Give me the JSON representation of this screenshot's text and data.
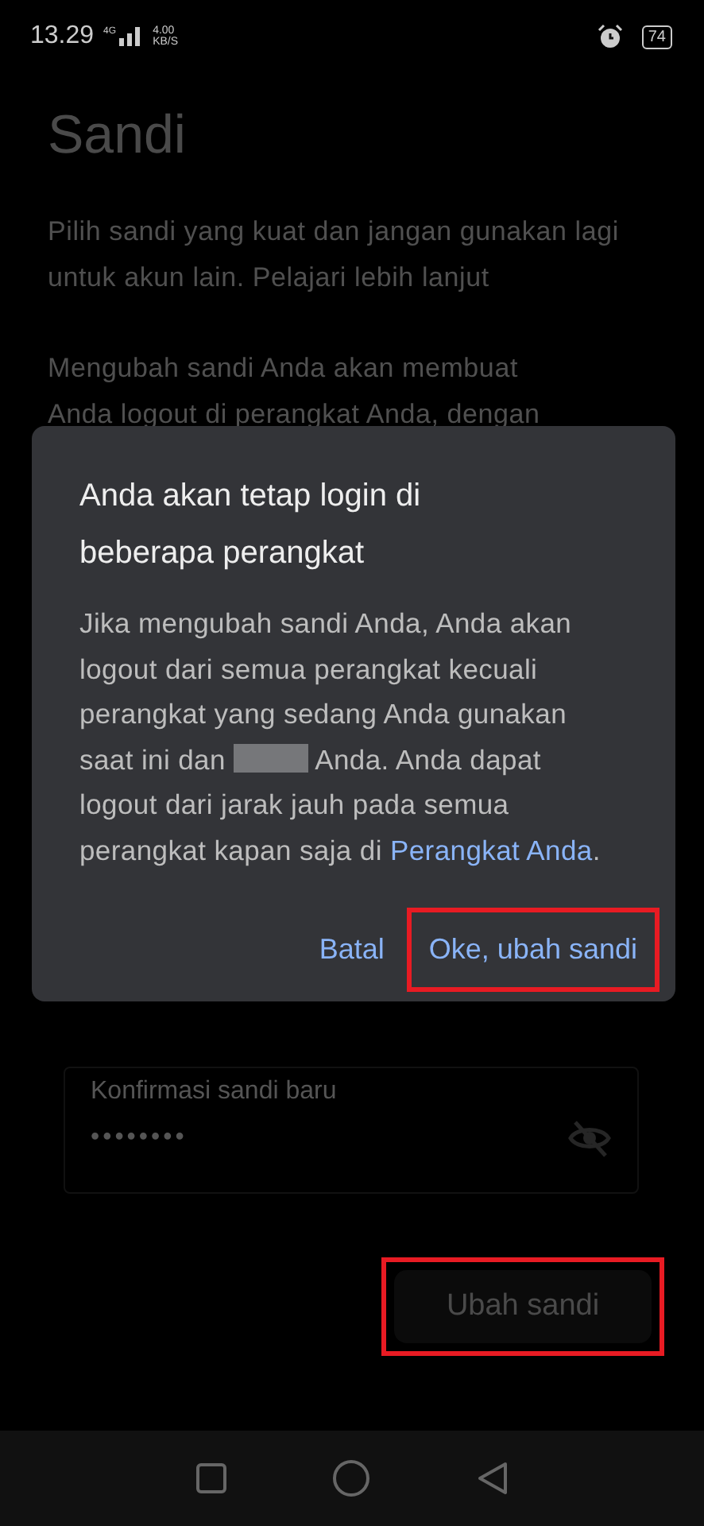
{
  "status_bar": {
    "time": "13.29",
    "network": "4G",
    "speed_value": "4.00",
    "speed_unit": "KB/S",
    "battery": "74"
  },
  "page": {
    "title": "Sandi",
    "intro": "Pilih sandi yang kuat dan jangan gunakan lagi untuk akun lain. Pelajari lebih lanjut",
    "notice_lines": [
      "Mengubah sandi Anda akan membuat",
      "Anda logout di perangkat Anda, dengan"
    ],
    "confirm_field": {
      "label": "Konfirmasi sandi baru",
      "value": "••••••••"
    },
    "submit": {
      "label": "Ubah sandi",
      "highlighted": true
    }
  },
  "dialog": {
    "title": "Anda akan tetap login di beberapa perangkat",
    "body_before": "Jika mengubah sandi Anda, Anda akan logout dari semua perangkat kecuali perangkat yang sedang Anda gunakan saat ini dan",
    "body_after": "Anda. Anda dapat logout dari jarak jauh pada semua perangkat kapan saja di",
    "link": "Perangkat Anda",
    "link_end": ".",
    "buttons": [
      {
        "label": "Batal",
        "highlighted": false
      },
      {
        "label": "Oke, ubah sandi",
        "highlighted": true
      }
    ]
  }
}
